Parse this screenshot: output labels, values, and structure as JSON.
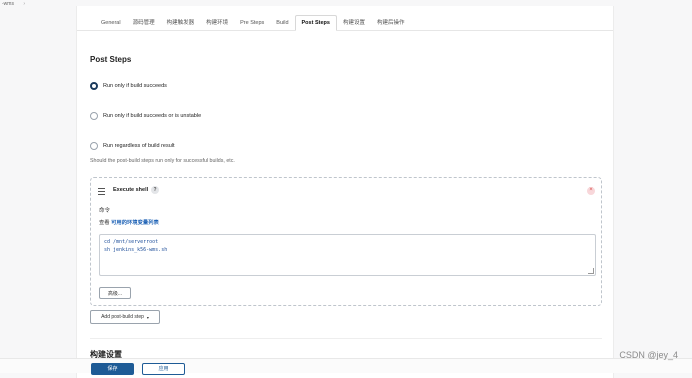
{
  "breadcrumb": {
    "item": "-wms",
    "separator": "›"
  },
  "tabs": [
    {
      "label": "General"
    },
    {
      "label": "源码管理"
    },
    {
      "label": "构建触发器"
    },
    {
      "label": "构建环境"
    },
    {
      "label": "Pre Steps"
    },
    {
      "label": "Build"
    },
    {
      "label": "Post Steps",
      "active": true
    },
    {
      "label": "构建设置"
    },
    {
      "label": "构建后操作"
    }
  ],
  "post_steps": {
    "title": "Post Steps",
    "options": [
      {
        "label": "Run only if build succeeds",
        "checked": true
      },
      {
        "label": "Run only if build succeeds or is unstable",
        "checked": false
      },
      {
        "label": "Run regardless of build result",
        "checked": false
      }
    ],
    "helper": "Should the post-build steps run only for successful builds, etc."
  },
  "execute_shell": {
    "title": "Execute shell",
    "help": "?",
    "close": "×",
    "command_label": "命令",
    "env_prefix": "查看",
    "env_link": "可用的环境变量列表",
    "code_lines": [
      "cd /mnt/serverroot",
      "sh jenkins_k56-wms.sh"
    ],
    "advanced_label": "高级..."
  },
  "add_step": {
    "label": "Add post-build step",
    "caret": "▾"
  },
  "next_section": {
    "title": "构建设置"
  },
  "actions": {
    "save": "保存",
    "apply": "应用"
  },
  "watermark": "CSDN @jey_4",
  "colors": {
    "primary": "#1e5b96",
    "link": "#1f63b6",
    "close": "#d9534f"
  }
}
